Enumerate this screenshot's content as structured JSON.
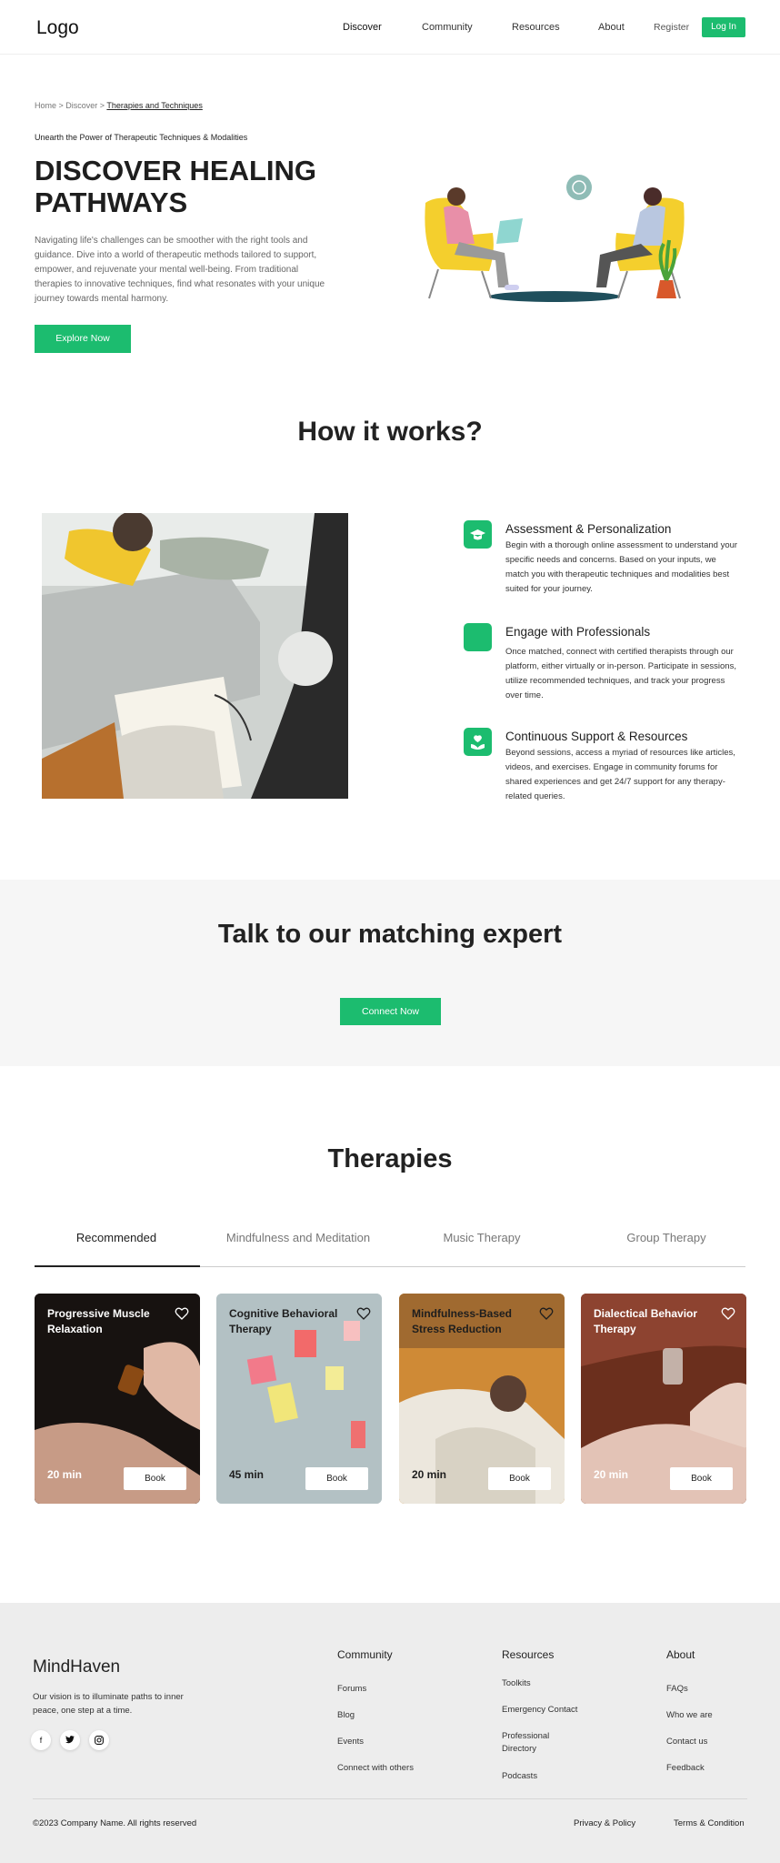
{
  "header": {
    "logo": "Logo",
    "nav": [
      "Discover",
      "Community",
      "Resources",
      "About"
    ],
    "register": "Register",
    "login": "Log In"
  },
  "hero": {
    "breadcrumb": {
      "home": "Home",
      "sep1": " > ",
      "discover": "Discover",
      "sep2": " > ",
      "current": "Therapies and Techniques"
    },
    "eyebrow": "Unearth the Power of Therapeutic Techniques & Modalities",
    "title": "DISCOVER HEALING PATHWAYS",
    "description": "Navigating life's challenges can be smoother with the right tools and guidance. Dive into a world of therapeutic methods tailored to support, empower, and rejuvenate your mental well-being. From traditional therapies to innovative techniques, find what resonates with your unique journey towards mental harmony.",
    "cta": "Explore Now"
  },
  "how": {
    "title": "How it works?",
    "steps": [
      {
        "title": "Assessment & Personalization",
        "desc": "Begin with a thorough online assessment to understand your specific needs and concerns. Based on your inputs, we match you with therapeutic techniques and modalities best suited for your journey.",
        "icon": "graduation-cap-icon"
      },
      {
        "title": "Engage with Professionals",
        "desc": "Once matched, connect with certified therapists through our platform, either virtually or in-person. Participate in sessions, utilize recommended techniques, and track your progress over time.",
        "icon": "professional-icon"
      },
      {
        "title": "Continuous Support & Resources",
        "desc": "Beyond sessions, access a myriad of resources like articles, videos, and exercises. Engage in community forums for shared experiences and get 24/7 support for any therapy-related queries.",
        "icon": "support-hands-icon"
      }
    ]
  },
  "cta": {
    "title": "Talk to our matching expert",
    "button": "Connect Now"
  },
  "therapies": {
    "title": "Therapies",
    "tabs": [
      "Recommended",
      "Mindfulness and Meditation",
      "Music Therapy",
      "Group Therapy"
    ],
    "cards": [
      {
        "title": "Progressive Muscle Relaxation",
        "duration": "20 min",
        "book": "Book"
      },
      {
        "title": "Cognitive Behavioral Therapy",
        "duration": "45 min",
        "book": "Book"
      },
      {
        "title": "Mindfulness-Based Stress Reduction",
        "duration": "20 min",
        "book": "Book"
      },
      {
        "title": "Dialectical Behavior Therapy",
        "duration": "20 min",
        "book": "Book"
      }
    ]
  },
  "footer": {
    "brand": "MindHaven",
    "vision": "Our vision is to illuminate paths to inner peace, one step at a time.",
    "social": [
      "f",
      "t",
      "ig"
    ],
    "columns": [
      {
        "title": "Community",
        "links": [
          "Forums",
          "Blog",
          "Events",
          "Connect with others"
        ]
      },
      {
        "title": "Resources",
        "links": [
          "Toolkits",
          "Emergency Contact",
          "Professional Directory",
          "Podcasts"
        ]
      },
      {
        "title": "About",
        "links": [
          "FAQs",
          "Who we are",
          "Contact us",
          "Feedback"
        ]
      }
    ],
    "copyright": "©2023 Company Name. All rights reserved",
    "privacy": "Privacy & Policy",
    "terms": "Terms & Condition"
  },
  "colors": {
    "accent": "#1cbc6f",
    "text": "#1e1e1e",
    "muted": "#666666",
    "cta_bg": "#f6f6f6",
    "footer_bg": "#ededed"
  }
}
